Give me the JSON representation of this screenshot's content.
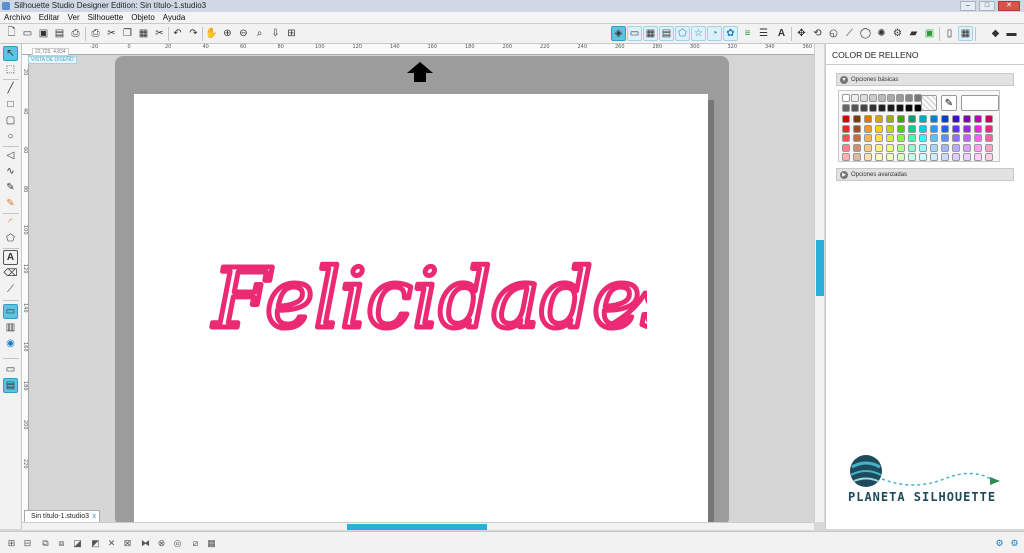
{
  "window": {
    "title": "Silhouette Studio Designer Edition: Sin título-1.studio3",
    "controls": [
      "minimize",
      "maximize",
      "close"
    ]
  },
  "menu": [
    "Archivo",
    "Editar",
    "Ver",
    "Silhouette",
    "Objeto",
    "Ayuda"
  ],
  "toolbar_left_icons": [
    "new-document-icon",
    "open-icon",
    "save-icon",
    "save-library-icon",
    "print-icon",
    "print-cut-icon",
    "cut-icon",
    "copy-icon",
    "paste-icon",
    "trash-icon",
    "undo-icon",
    "redo-icon",
    "pan-icon",
    "zoom-in-icon",
    "zoom-out-icon",
    "zoom-select-icon",
    "zoom-drag-icon",
    "fit-page-icon"
  ],
  "toolbar_right_icons": [
    "design-area-icon",
    "page-setup-icon",
    "grid-icon",
    "registration-icon",
    "pentagon-icon",
    "star-icon",
    "library-icon",
    "replicate-icon",
    "align-icon",
    "line-style-icon",
    "fill-color-icon",
    "text-style-icon",
    "transform-icon",
    "rotate-icon",
    "scale-icon",
    "knife-icon",
    "offset-icon",
    "trace-icon",
    "weld-icon",
    "modify-icon",
    "fill-pattern-icon",
    "gradient-icon",
    "library-store-icon",
    "send-icon",
    "cut-settings-icon",
    "layer-icon",
    "eraser-icon",
    "pen-icon"
  ],
  "left_tools": [
    "select-tool-icon",
    "point-edit-icon",
    "line-tool-icon",
    "rectangle-tool-icon",
    "rounded-rectangle-icon",
    "ellipse-tool-icon",
    "polygon-tool-icon",
    "curve-tool-icon",
    "freehand-tool-icon",
    "smooth-freehand-icon",
    "arc-tool-icon",
    "regular-polygon-icon",
    "text-tool-icon",
    "eraser-tool-icon",
    "knife-tool-icon",
    "view-design-icon",
    "library-view-icon",
    "store-icon",
    "mat-view-icon",
    "split-view-icon"
  ],
  "rulers": {
    "coordinate_readout": "22,725, 4,834",
    "top_ticks": [
      "-20",
      "0",
      "20",
      "40",
      "60",
      "80",
      "100",
      "120",
      "140",
      "160",
      "180",
      "200",
      "220",
      "240",
      "260",
      "280",
      "300",
      "320",
      "340",
      "360"
    ],
    "left_ticks": [
      "20",
      "40",
      "60",
      "80",
      "100",
      "120",
      "140",
      "160",
      "180",
      "200",
      "220"
    ]
  },
  "canvas": {
    "mode_label": "VISTA DE DISEÑO",
    "artwork_text": "Felicidades",
    "artwork_color": "#ec2a74",
    "feed_arrow": "feed-direction-arrow"
  },
  "document_tab": {
    "label": "Sin título-1.studio3",
    "close_symbol": "x"
  },
  "panel": {
    "title": "COLOR DE RELLENO",
    "basic_section": "Opciones básicas",
    "advanced_section": "Opciones avanzadas",
    "gray_row": [
      "#ffffff",
      "#eeeeee",
      "#dddddd",
      "#cccccc",
      "#bbbbbb",
      "#aaaaaa",
      "#999999",
      "#888888",
      "#777777"
    ],
    "gray_row2": [
      "#666666",
      "#555555",
      "#444444",
      "#333333",
      "#222222",
      "#1a1a1a",
      "#111111",
      "#080808",
      "#000000"
    ],
    "color_grid": [
      [
        "#d40000",
        "#7a3d00",
        "#e07800",
        "#d4a800",
        "#9ab000",
        "#3aa600",
        "#00a070",
        "#00a8c0",
        "#0080d0",
        "#0040c8",
        "#3a10c0",
        "#8000c0",
        "#c000b0",
        "#d00060"
      ],
      [
        "#ff2020",
        "#a05020",
        "#ff9a20",
        "#ffd000",
        "#c0d800",
        "#50d000",
        "#00d090",
        "#00d0e8",
        "#20a0ff",
        "#2060ff",
        "#6030ff",
        "#a020ff",
        "#ff20e0",
        "#ff2080"
      ],
      [
        "#ff5050",
        "#c07040",
        "#ffb050",
        "#ffe040",
        "#d8f040",
        "#80ff30",
        "#40ffb0",
        "#40f0ff",
        "#60c0ff",
        "#6090ff",
        "#9070ff",
        "#c060ff",
        "#ff60f0",
        "#ff60a0"
      ],
      [
        "#ff8080",
        "#d09070",
        "#ffc880",
        "#fff080",
        "#e8ff80",
        "#b0ff80",
        "#90ffd0",
        "#90f8ff",
        "#a0d8ff",
        "#a0b8ff",
        "#b8a8ff",
        "#d8a0ff",
        "#ffa0f8",
        "#ffa0c8"
      ],
      [
        "#ffb0b0",
        "#e0b8a0",
        "#ffe0b0",
        "#fff8c0",
        "#f0ffc0",
        "#d8ffc0",
        "#c8ffe8",
        "#c8fcff",
        "#d0ecff",
        "#d0dcff",
        "#dcd0ff",
        "#ecd0ff",
        "#ffd0fc",
        "#ffd0e4"
      ]
    ],
    "selected_color": "#ec2a74",
    "brand_text": "PLANETA SILHOUETTE",
    "brand_colors": {
      "planet": "#1e4a5c",
      "accent": "#46b4c8"
    }
  },
  "bottom_icons": [
    "group-icon",
    "ungroup-icon",
    "compound-path-icon",
    "release-compound-icon",
    "bring-front-icon",
    "send-back-icon",
    "duplicate-icon",
    "delete-icon",
    "weld-bottom-icon",
    "offset-bottom-icon",
    "trace-bottom-icon",
    "settings-gear-icon",
    "help-icon"
  ]
}
